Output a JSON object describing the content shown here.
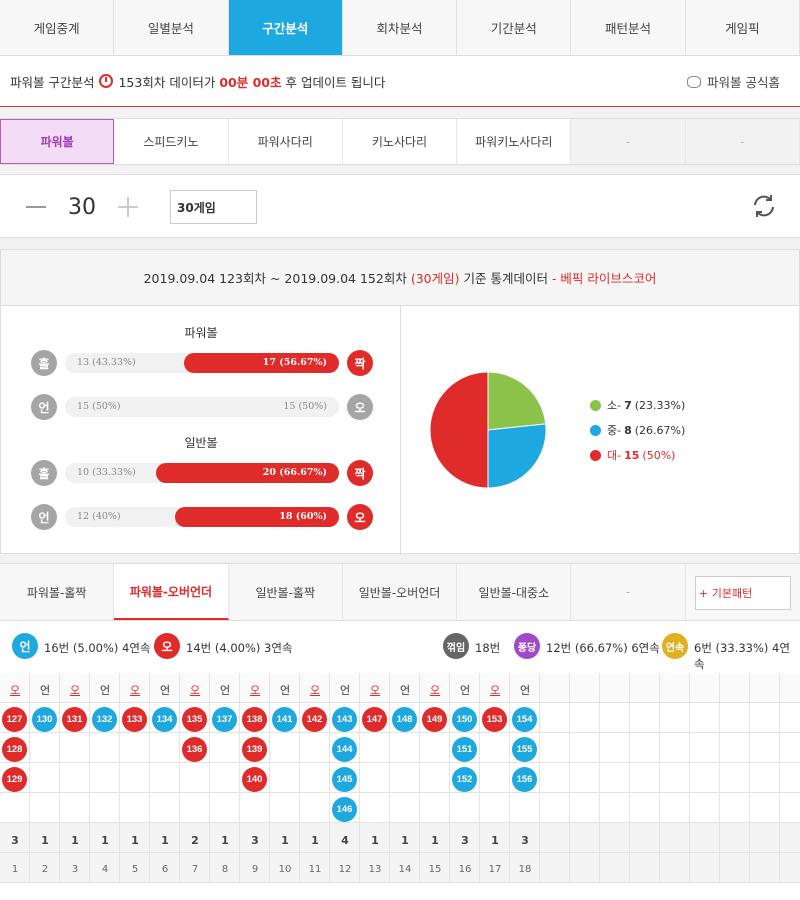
{
  "topnav": [
    "게임중계",
    "일별분석",
    "구간분석",
    "회차분석",
    "기간분석",
    "패턴분석",
    "게임픽"
  ],
  "notice": {
    "prefix": "파워볼 구간분석",
    "round": "153회차",
    "mid": "데이터가",
    "time": "00분 00초",
    "suffix": "후 업데이트 됩니다",
    "home": "파워볼 공식홈"
  },
  "gametabs": [
    "파워볼",
    "스피드키노",
    "파워사다리",
    "키노사다리",
    "파워키노사다리",
    "-",
    "-"
  ],
  "counter": {
    "value": "30",
    "select": "30게임"
  },
  "stats": {
    "range": "2019.09.04 123회차 ~ 2019.09.04 152회차",
    "games": "(30게임)",
    "basis": "기준 통계데이터",
    "brand": "- 베픽 라이브스코어",
    "pb_title": "파워볼",
    "nb_title": "일반볼",
    "rows": [
      {
        "left_icon": "홀",
        "left": "13 (43.33%)",
        "right": "17 (56.67%)",
        "right_icon": "짝",
        "fill": 0.5667,
        "winner": "right"
      },
      {
        "left_icon": "언",
        "left": "15 (50%)",
        "right": "15 (50%)",
        "right_icon": "오",
        "fill": 0,
        "winner": "none"
      },
      {
        "left_icon": "홀",
        "left": "10 (33.33%)",
        "right": "20 (66.67%)",
        "right_icon": "짝",
        "fill": 0.6667,
        "winner": "right"
      },
      {
        "left_icon": "언",
        "left": "12 (40%)",
        "right": "18 (60%)",
        "right_icon": "오",
        "fill": 0.6,
        "winner": "right"
      }
    ]
  },
  "chart_data": {
    "type": "pie",
    "slices": [
      {
        "label": "소",
        "count": "7",
        "pct": "(23.33%)",
        "value": 23.33,
        "color": "#8bc34a"
      },
      {
        "label": "중",
        "count": "8",
        "pct": "(26.67%)",
        "value": 26.67,
        "color": "#1ea8e0"
      },
      {
        "label": "대",
        "count": "15",
        "pct": "(50%)",
        "value": 50,
        "color": "#e02b2b"
      }
    ]
  },
  "patterntabs": [
    "파워볼-홀짝",
    "파워볼-오버언더",
    "일반볼-홀짝",
    "일반볼-오버언더",
    "일반볼-대중소",
    "-"
  ],
  "pattern_button": "+ 기본패턴",
  "summary": {
    "u_icon": "언",
    "u_text": "16번 (5.00%) 4연속",
    "o_icon": "오",
    "o_text": "14번 (4.00%) 3연속",
    "k_icon": "꺾임",
    "k_text": "18번",
    "p_icon": "퐁당",
    "p_text": "12번 (66.67%) 6연속",
    "y_icon": "연속",
    "y_text": "6번 (33.33%) 4연속"
  },
  "columns": [
    {
      "h": "오",
      "t": "o",
      "balls": [
        "127",
        "128",
        "129"
      ]
    },
    {
      "h": "언",
      "t": "u",
      "balls": [
        "130"
      ]
    },
    {
      "h": "오",
      "t": "o",
      "balls": [
        "131"
      ]
    },
    {
      "h": "언",
      "t": "u",
      "balls": [
        "132"
      ]
    },
    {
      "h": "오",
      "t": "o",
      "balls": [
        "133"
      ]
    },
    {
      "h": "언",
      "t": "u",
      "balls": [
        "134"
      ]
    },
    {
      "h": "오",
      "t": "o",
      "balls": [
        "135",
        "136"
      ]
    },
    {
      "h": "언",
      "t": "u",
      "balls": [
        "137"
      ]
    },
    {
      "h": "오",
      "t": "o",
      "balls": [
        "138",
        "139",
        "140"
      ]
    },
    {
      "h": "언",
      "t": "u",
      "balls": [
        "141"
      ]
    },
    {
      "h": "오",
      "t": "o",
      "balls": [
        "142"
      ]
    },
    {
      "h": "언",
      "t": "u",
      "balls": [
        "143",
        "144",
        "145",
        "146"
      ]
    },
    {
      "h": "오",
      "t": "o",
      "balls": [
        "147"
      ]
    },
    {
      "h": "언",
      "t": "u",
      "balls": [
        "148"
      ]
    },
    {
      "h": "오",
      "t": "o",
      "balls": [
        "149"
      ]
    },
    {
      "h": "언",
      "t": "u",
      "balls": [
        "150",
        "151",
        "152"
      ]
    },
    {
      "h": "오",
      "t": "o",
      "balls": [
        "153"
      ]
    },
    {
      "h": "언",
      "t": "u",
      "balls": [
        "154",
        "155",
        "156"
      ]
    }
  ],
  "counts": [
    "3",
    "1",
    "1",
    "1",
    "1",
    "1",
    "2",
    "1",
    "3",
    "1",
    "1",
    "4",
    "1",
    "1",
    "1",
    "3",
    "1",
    "3"
  ],
  "indices": [
    "1",
    "2",
    "3",
    "4",
    "5",
    "6",
    "7",
    "8",
    "9",
    "10",
    "11",
    "12",
    "13",
    "14",
    "15",
    "16",
    "17",
    "18"
  ]
}
